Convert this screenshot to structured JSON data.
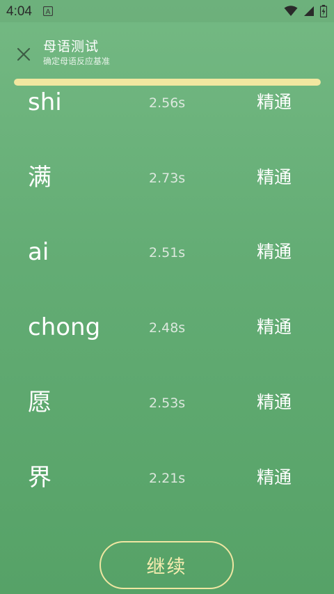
{
  "status_bar": {
    "time": "4:04",
    "notification_letter": "A"
  },
  "header": {
    "title": "母语测试",
    "subtitle": "确定母语反应基准"
  },
  "progress": {
    "fraction": 1.0,
    "color": "#f1e7a0"
  },
  "results": [
    {
      "word": "shi",
      "time": "2.56s",
      "level": "精通"
    },
    {
      "word": "满",
      "time": "2.73s",
      "level": "精通"
    },
    {
      "word": "ai",
      "time": "2.51s",
      "level": "精通"
    },
    {
      "word": "chong",
      "time": "2.48s",
      "level": "精通"
    },
    {
      "word": "愿",
      "time": "2.53s",
      "level": "精通"
    },
    {
      "word": "界",
      "time": "2.21s",
      "level": "精通"
    }
  ],
  "continue_label": "继续",
  "colors": {
    "background_top": "#74b983",
    "background_bottom": "#56a267",
    "accent": "#efe6a2"
  }
}
